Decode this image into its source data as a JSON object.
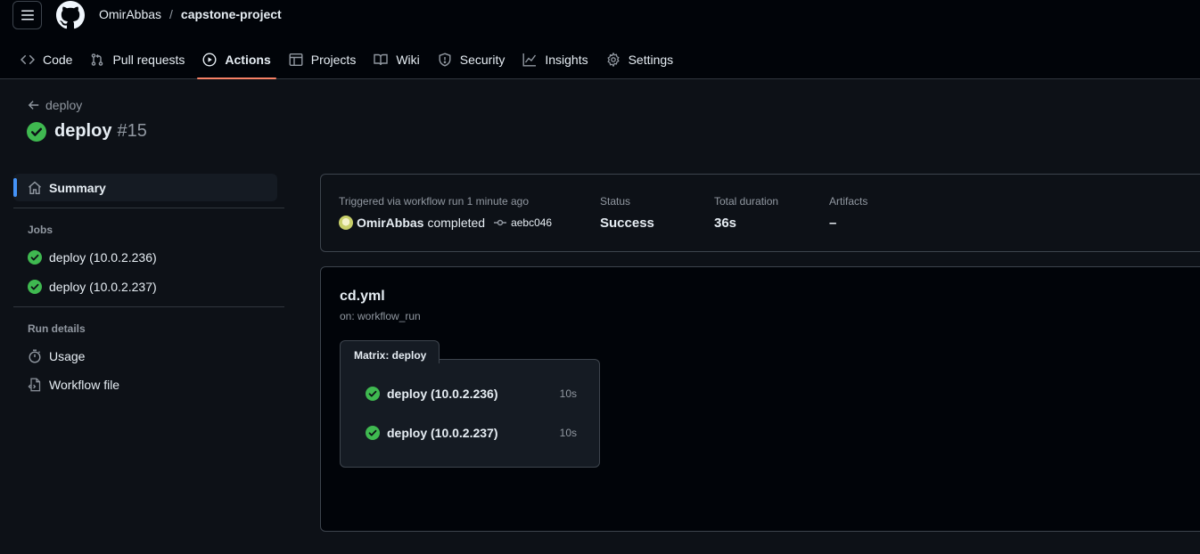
{
  "header": {
    "owner": "OmirAbbas",
    "separator": "/",
    "repo": "capstone-project",
    "tabs": [
      {
        "label": "Code",
        "icon": "code-icon"
      },
      {
        "label": "Pull requests",
        "icon": "pull-request-icon"
      },
      {
        "label": "Actions",
        "icon": "play-icon",
        "active": true
      },
      {
        "label": "Projects",
        "icon": "table-icon"
      },
      {
        "label": "Wiki",
        "icon": "book-icon"
      },
      {
        "label": "Security",
        "icon": "shield-icon"
      },
      {
        "label": "Insights",
        "icon": "graph-icon"
      },
      {
        "label": "Settings",
        "icon": "gear-icon"
      }
    ]
  },
  "run": {
    "back_label": "deploy",
    "name": "deploy",
    "number": "#15",
    "status_color": "#3fb950"
  },
  "sidebar": {
    "summary_label": "Summary",
    "jobs_heading": "Jobs",
    "jobs": [
      "deploy (10.0.2.236)",
      "deploy (10.0.2.237)"
    ],
    "details_heading": "Run details",
    "usage_label": "Usage",
    "workflow_file_label": "Workflow file"
  },
  "summary": {
    "trigger_label": "Triggered via workflow run 1 minute ago",
    "actor": "OmirAbbas",
    "actor_verb": "completed",
    "commit": "aebc046",
    "status_label": "Status",
    "status_value": "Success",
    "duration_label": "Total duration",
    "duration_value": "36s",
    "artifacts_label": "Artifacts",
    "artifacts_value": "–"
  },
  "workflow": {
    "file": "cd.yml",
    "trigger": "on: workflow_run",
    "matrix_label": "Matrix: deploy",
    "jobs": [
      {
        "name": "deploy (10.0.2.236)",
        "duration": "10s"
      },
      {
        "name": "deploy (10.0.2.237)",
        "duration": "10s"
      }
    ]
  },
  "colors": {
    "accent": "#f78166",
    "success": "#3fb950",
    "selected": "#4493f8"
  }
}
